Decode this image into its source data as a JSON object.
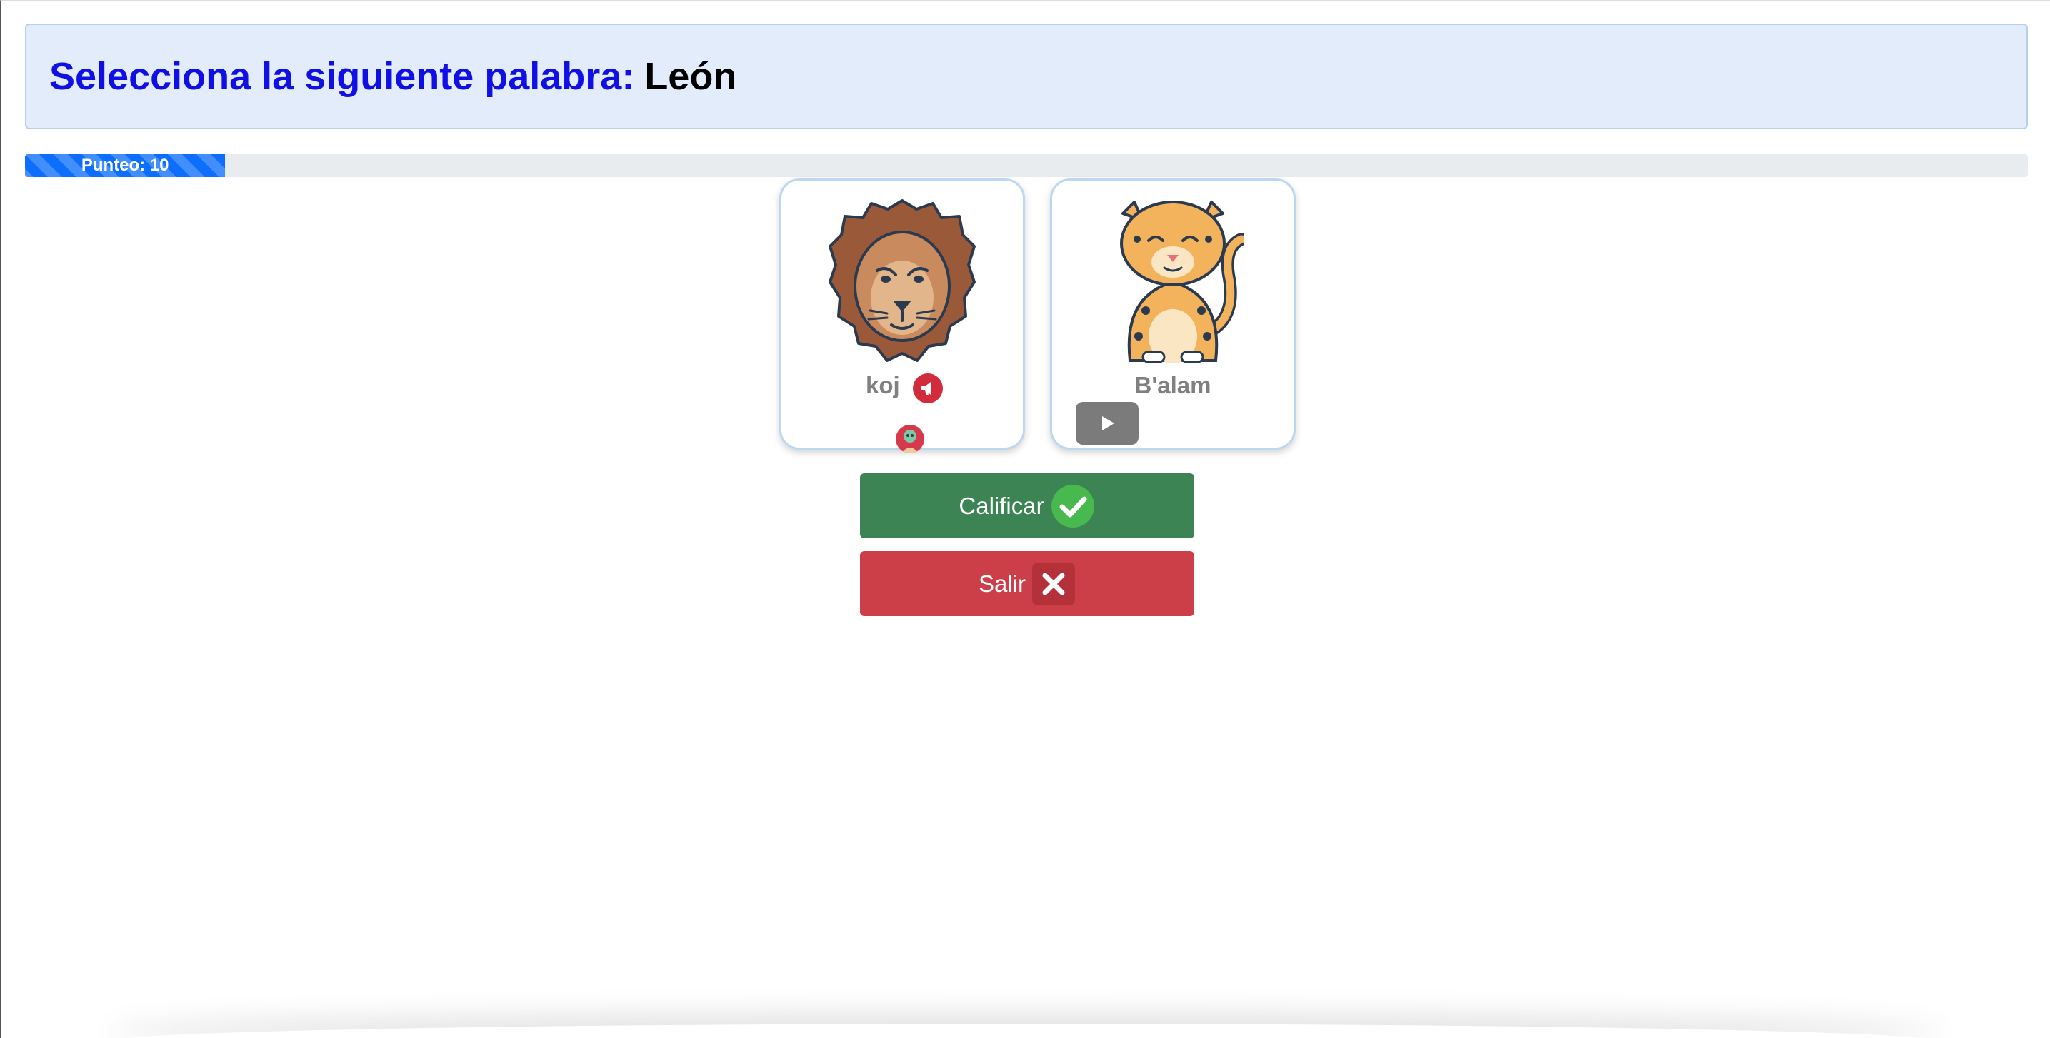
{
  "prompt": {
    "instruction": "Selecciona la siguiente palabra:",
    "target_word": "León"
  },
  "progress": {
    "label": "Punteo: 10",
    "fraction": 0.1
  },
  "cards": [
    {
      "word": "koj",
      "image_icon": "lion-icon",
      "audio_icon": "speaker-icon",
      "badge_icon": "avatar-icon"
    },
    {
      "word": "B'alam",
      "image_icon": "jaguar-icon",
      "audio_icon": "play-icon"
    }
  ],
  "buttons": {
    "grade_label": "Calificar",
    "grade_icon": "check-icon",
    "exit_label": "Salir",
    "exit_icon": "close-icon"
  },
  "colors": {
    "prompt_blue": "#1010e6",
    "progress_blue": "#0d6efd",
    "grade_green": "#3c8454",
    "exit_red": "#cc3f48"
  }
}
